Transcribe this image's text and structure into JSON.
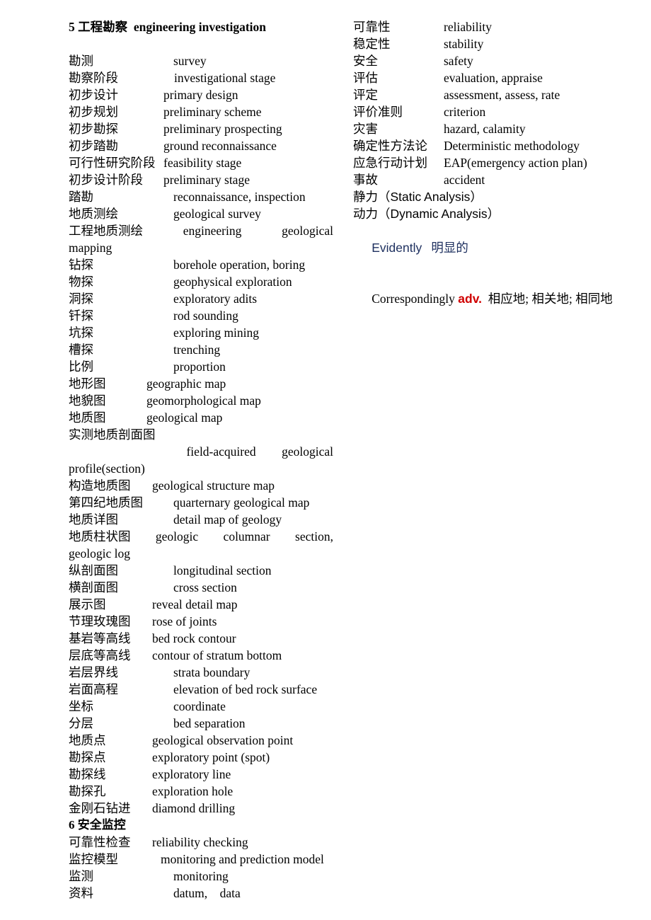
{
  "document": {
    "title": "5 工程勘察  engineering investigation",
    "colors": {
      "text": "#000000",
      "accent_navy": "#1f3160",
      "accent_red": "#d00000"
    }
  },
  "left_column": {
    "heading": "5 工程勘察  engineering investigation",
    "section_heading": "6 安全监控",
    "entries": [
      {
        "cn": "勘测",
        "en": "survey",
        "indent": 148
      },
      {
        "cn": "勘察阶段",
        "en": "investigational stage",
        "indent": 149
      },
      {
        "cn": "初步设计",
        "en": "primary design",
        "indent": 134
      },
      {
        "cn": "初步规划",
        "en": "preliminary scheme",
        "indent": 134
      },
      {
        "cn": "初步勘探",
        "en": "preliminary prospecting",
        "indent": 134
      },
      {
        "cn": "初步踏勘",
        "en": "ground reconnaissance",
        "indent": 134
      },
      {
        "cn": "可行性研究阶段",
        "en": "feasibility stage",
        "indent": 134
      },
      {
        "cn": "初步设计阶段",
        "en": "preliminary stage",
        "indent": 134
      },
      {
        "cn": "踏勘",
        "en": "reconnaissance, inspection",
        "indent": 148
      },
      {
        "cn": "地质测绘",
        "en": "geological survey",
        "indent": 148
      },
      {
        "cn": "工程地质测绘",
        "en_parts": [
          "engineering",
          "geological"
        ],
        "justify": true,
        "cont": "mapping"
      },
      {
        "cn": "钻探",
        "en": "borehole operation, boring",
        "indent": 148
      },
      {
        "cn": "物探",
        "en": "geophysical exploration",
        "indent": 148
      },
      {
        "cn": "洞探",
        "en": "exploratory adits",
        "indent": 148
      },
      {
        "cn": "钎探",
        "en": "rod sounding",
        "indent": 148
      },
      {
        "cn": "坑探",
        "en": "exploring mining",
        "indent": 148
      },
      {
        "cn": "槽探",
        "en": "trenching",
        "indent": 148
      },
      {
        "cn": "比例",
        "en": "proportion",
        "indent": 148
      },
      {
        "cn": "地形图",
        "en": "geographic map",
        "indent": 110
      },
      {
        "cn": "地貌图",
        "en": "geomorphological map",
        "indent": 110
      },
      {
        "cn": "地质图",
        "en": "geological map",
        "indent": 110
      },
      {
        "cn": "实测地质剖面图",
        "en": "",
        "indent": 0,
        "own_line": true
      },
      {
        "cn": "",
        "en_parts": [
          "field-acquired",
          "geological"
        ],
        "justify": true,
        "lead": 130,
        "cont": "profile(section)"
      },
      {
        "cn": "构造地质图",
        "en": "geological structure map",
        "indent": 118
      },
      {
        "cn": "第四纪地质图",
        "en": "quarternary geological map",
        "indent": 148
      },
      {
        "cn": "地质详图",
        "en": "detail map of geology",
        "indent": 148
      },
      {
        "cn": "地质柱状图",
        "en_parts": [
          "geologic",
          "columnar",
          "section,"
        ],
        "justify": true,
        "cont": "geologic log"
      },
      {
        "cn": "纵剖面图",
        "en": "longitudinal section",
        "indent": 148
      },
      {
        "cn": "横剖面图",
        "en": "cross section",
        "indent": 148
      },
      {
        "cn": "展示图",
        "en": "reveal detail map",
        "indent": 118
      },
      {
        "cn": "节理玫瑰图",
        "en": "rose of joints",
        "indent": 118
      },
      {
        "cn": "基岩等高线",
        "en": "bed rock contour",
        "indent": 118
      },
      {
        "cn": "层底等高线",
        "en": "contour of stratum bottom",
        "indent": 118
      },
      {
        "cn": "岩层界线",
        "en": "strata boundary",
        "indent": 148
      },
      {
        "cn": "岩面高程",
        "en": "elevation of bed rock surface",
        "indent": 148
      },
      {
        "cn": "坐标",
        "en": "coordinate",
        "indent": 148
      },
      {
        "cn": "分层",
        "en": "bed separation",
        "indent": 148
      },
      {
        "cn": "地质点",
        "en": "geological observation point",
        "indent": 118
      },
      {
        "cn": "勘探点",
        "en": "exploratory point (spot)",
        "indent": 118
      },
      {
        "cn": "勘探线",
        "en": "exploratory line",
        "indent": 118
      },
      {
        "cn": "勘探孔",
        "en": "exploration hole",
        "indent": 118
      },
      {
        "cn": "金刚石钻进",
        "en": "diamond drilling",
        "indent": 118
      }
    ],
    "entries_after_section": [
      {
        "cn": "可靠性检查",
        "en": "reliability checking",
        "indent": 118
      },
      {
        "cn": "监控模型",
        "en": "monitoring and prediction model",
        "indent": 130
      },
      {
        "cn": "监测",
        "en": "monitoring",
        "indent": 148
      },
      {
        "cn": "资料",
        "en": "datum,    data",
        "indent": 148
      }
    ]
  },
  "right_column": {
    "entries": [
      {
        "cn": "可靠性",
        "en": "reliability",
        "indent": 128
      },
      {
        "cn": "稳定性",
        "en": "stability",
        "indent": 128
      },
      {
        "cn": "安全",
        "en": "safety",
        "indent": 128
      },
      {
        "cn": "评估",
        "en": "evaluation, appraise",
        "indent": 128
      },
      {
        "cn": "评定",
        "en": "assessment, assess, rate",
        "indent": 128
      },
      {
        "cn": "评价准则",
        "en": "criterion",
        "indent": 128
      },
      {
        "cn": "灾害",
        "en": "hazard, calamity",
        "indent": 128
      },
      {
        "cn": "确定性方法论",
        "en": "Deterministic methodology",
        "indent": 128
      },
      {
        "cn": "应急行动计划",
        "en": "EAP(emergency action plan)",
        "indent": 128
      },
      {
        "cn": "事故",
        "en": "accident",
        "indent": 128
      }
    ],
    "special_entries": [
      {
        "cn": "静力（",
        "en_sans": "Static Analysis",
        "cn_tail": "）"
      },
      {
        "cn": "动力（",
        "en_sans": "Dynamic Analysis",
        "cn_tail": "）"
      }
    ],
    "evidently": {
      "word": "Evidently",
      "gloss": "明显的"
    },
    "correspondingly": {
      "word": "Correspondingly ",
      "pos": "adv.",
      "gloss": "  相应地; 相关地; 相同地"
    }
  }
}
